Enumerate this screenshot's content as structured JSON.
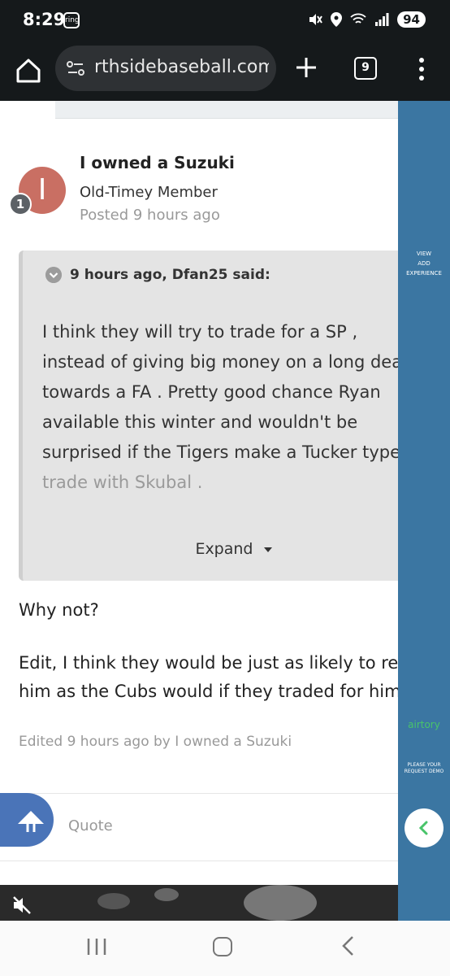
{
  "status_bar": {
    "time": "8:29",
    "notification_badge": "ring",
    "battery": "94"
  },
  "browser": {
    "url": "rthsidebaseball.com",
    "tab_count": "9"
  },
  "post": {
    "author": "I owned a Suzuki",
    "avatar_letter": "I",
    "rank_badge": "1",
    "member_title": "Old-Timey Member",
    "posted": "Posted 9 hours ago",
    "quote": {
      "header": "9 hours ago, Dfan25 said:",
      "lines": [
        "I think they will try to trade for a SP ,",
        "instead of giving big money on a long dea",
        "towards a FA .   Pretty good chance Ryan",
        "available this winter and wouldn't be",
        "surprised if the Tigers make a Tucker type",
        "trade with Skubal ."
      ],
      "expand_label": "Expand"
    },
    "reply_line1": "Why not?",
    "reply_line2": "Edit, I think they would be just as likely to re",
    "reply_line3": "him as the Cubs would if they traded for him",
    "edited_note": "Edited 9 hours ago by I owned a Suzuki",
    "quote_action": "Quote"
  },
  "side_ad": {
    "view_text_1": "VIEW",
    "view_text_2": "ADD",
    "view_text_3": "EXPERIENCE",
    "brand": "airtory",
    "request_text_1": "PLEASE YOUR",
    "request_text_2": "REQUEST DEMO"
  },
  "colors": {
    "avatar": "#c96f63",
    "side_ad": "#3b76a2",
    "scroll_button": "#4a74b8",
    "brand_green": "#49c46a"
  }
}
